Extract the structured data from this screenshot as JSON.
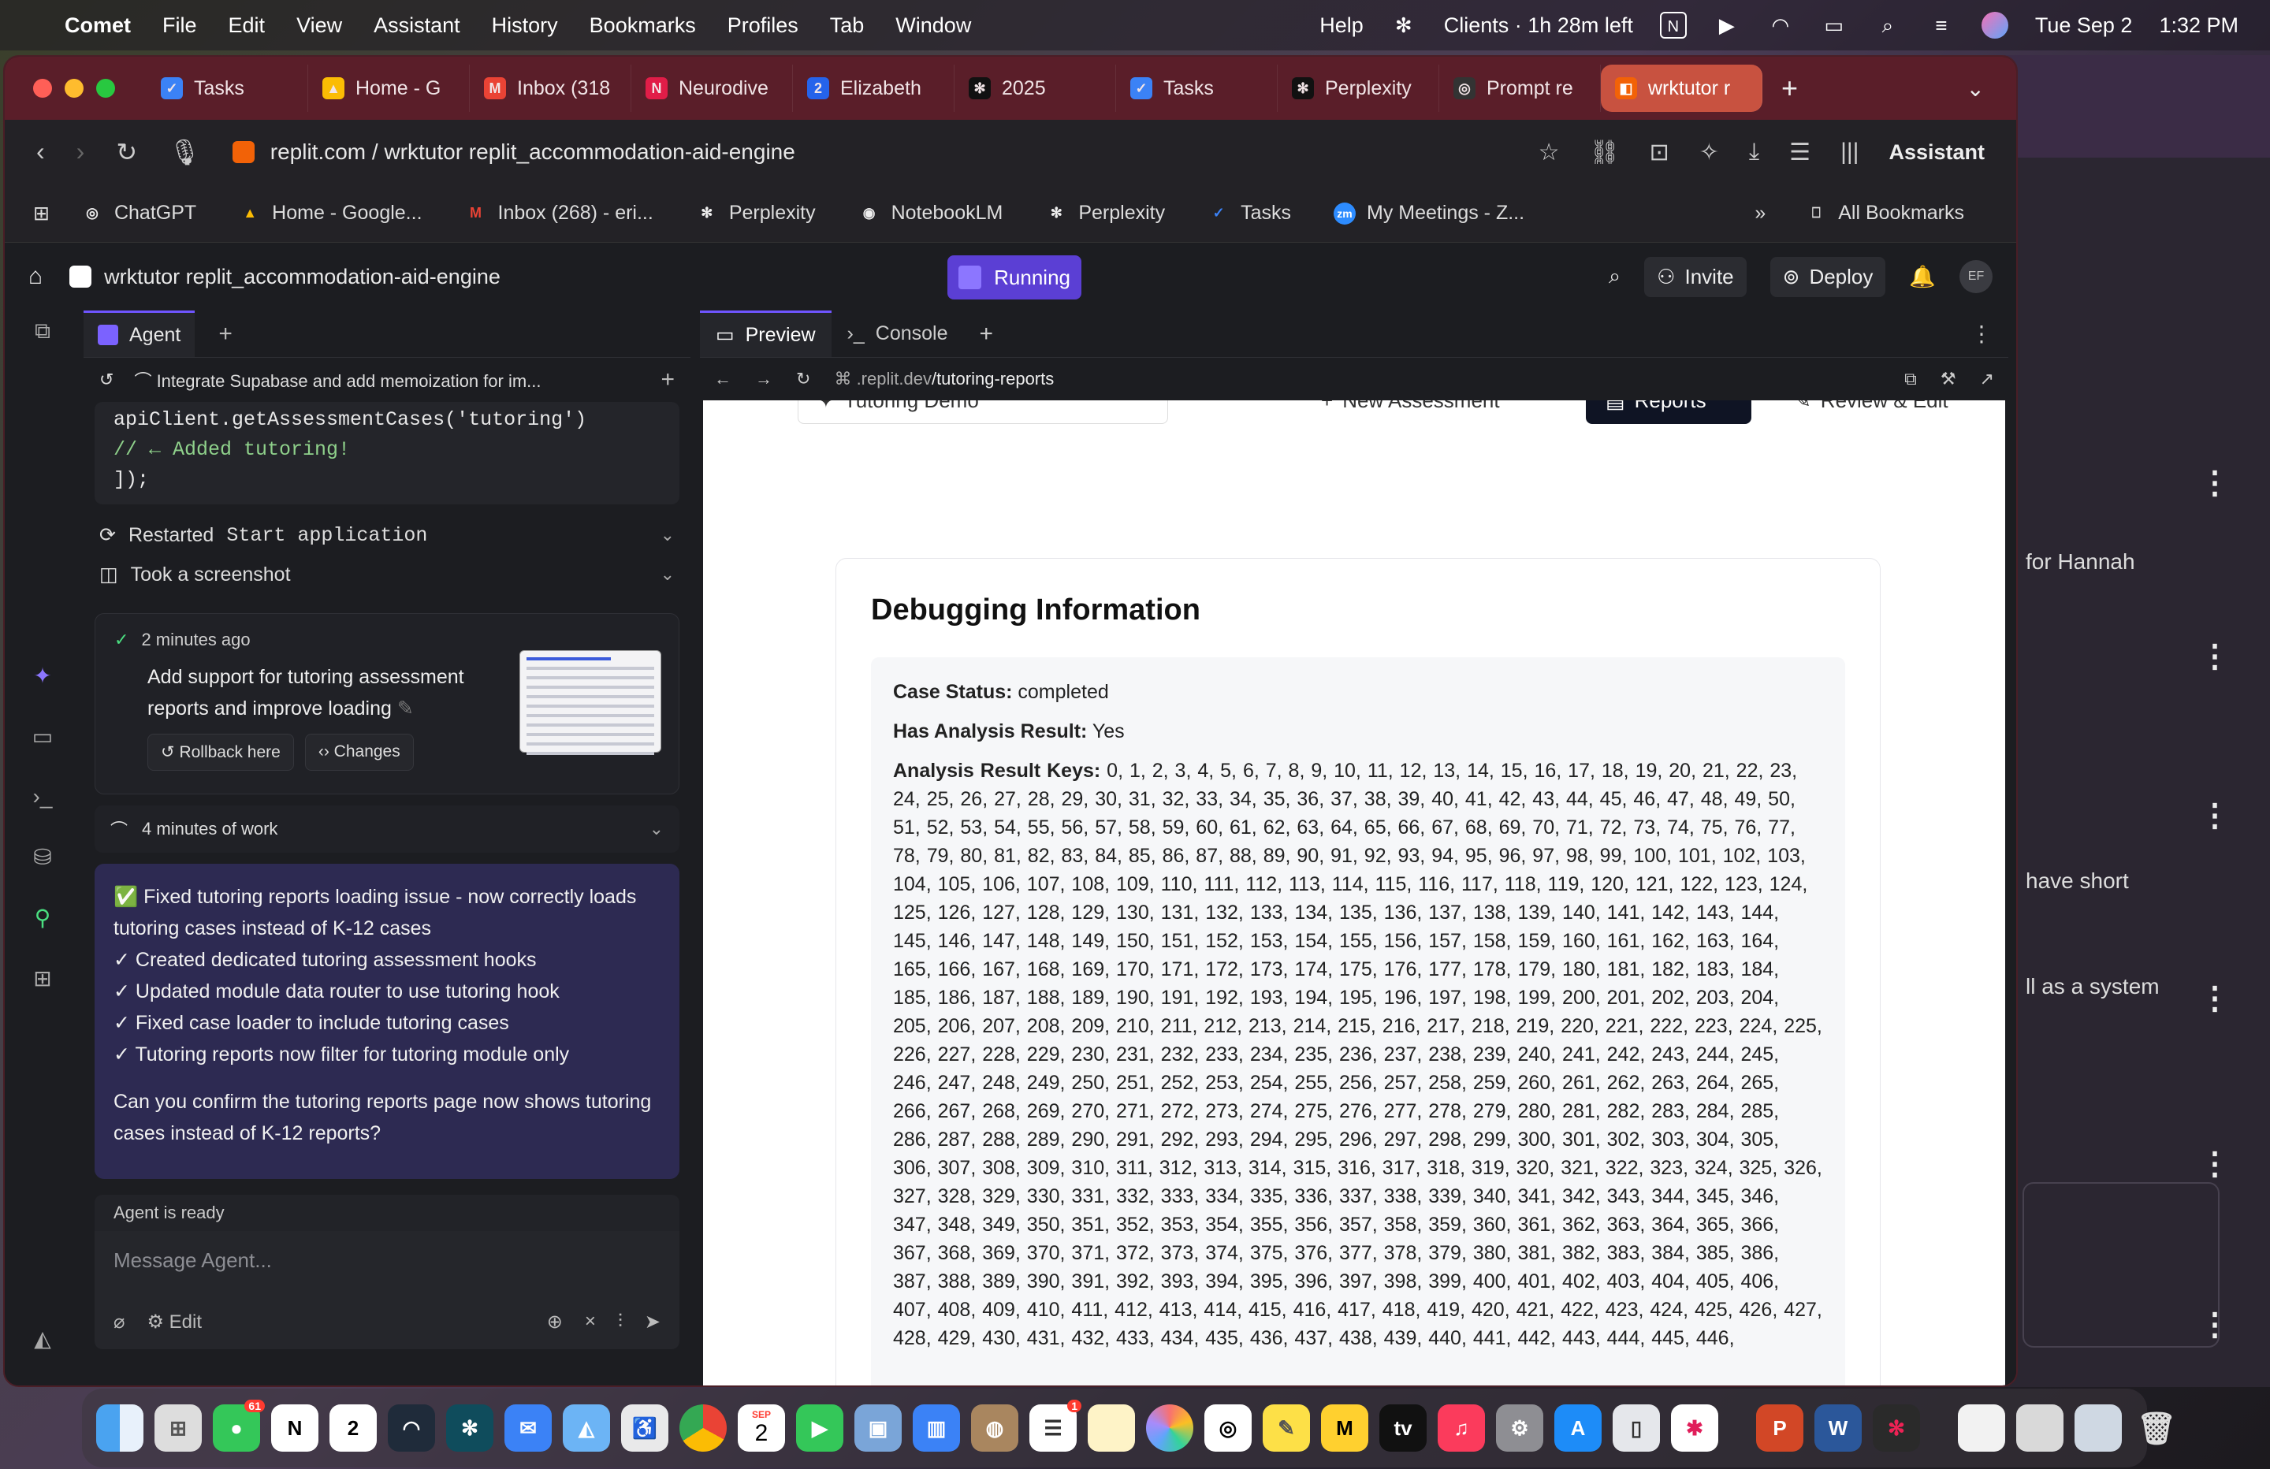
{
  "menubar": {
    "app": "Comet",
    "items": [
      "File",
      "Edit",
      "View",
      "Assistant",
      "History",
      "Bookmarks",
      "Profiles",
      "Tab",
      "Window"
    ],
    "help": "Help",
    "timer": "Clients · 1h 28m left",
    "date": "Tue Sep 2",
    "time": "1:32 PM"
  },
  "tabs": [
    {
      "label": "Tasks",
      "color": "#3b82f6"
    },
    {
      "label": "Home - G",
      "color": "#fbbc04"
    },
    {
      "label": "Inbox (318",
      "color": "#ea4335"
    },
    {
      "label": "Neurodive",
      "color": "#e11d48"
    },
    {
      "label": "Elizabeth",
      "color": "#2563eb"
    },
    {
      "label": "2025",
      "color": "#111111"
    },
    {
      "label": "Tasks",
      "color": "#3b82f6"
    },
    {
      "label": "Perplexity",
      "color": "#111111"
    },
    {
      "label": "Prompt re",
      "color": "#333333"
    },
    {
      "label": "wrktutor r",
      "color": "#f26207"
    }
  ],
  "toolbar": {
    "url": "replit.com / wrktutor replit_accommodation-aid-engine",
    "assistant": "Assistant"
  },
  "bookmarks": [
    {
      "label": "ChatGPT",
      "color": "#222222"
    },
    {
      "label": "Home - Google...",
      "color": "#fbbc04"
    },
    {
      "label": "Inbox (268) - eri...",
      "color": "#ea4335"
    },
    {
      "label": "Perplexity",
      "color": "#111111"
    },
    {
      "label": "NotebookLM",
      "color": "#222222"
    },
    {
      "label": "Perplexity",
      "color": "#111111"
    },
    {
      "label": "Tasks",
      "color": "#3b82f6"
    },
    {
      "label": "My Meetings - Z...",
      "color": "#2d8cff"
    }
  ],
  "all_bookmarks": "All Bookmarks",
  "replit": {
    "project": "wrktutor replit_accommodation-aid-engine",
    "status": "Running",
    "invite": "Invite",
    "deploy": "Deploy",
    "avatar": "EF"
  },
  "agent": {
    "tab": "Agent",
    "thread": "Integrate Supabase and add memoization for im...",
    "code": {
      "line1": "  apiClient.getAssessmentCases('tutoring')",
      "line2": "// ← Added tutoring!",
      "line3": "]);"
    },
    "restarted_prefix": "Restarted",
    "restarted_target": "Start application",
    "screenshot": "Took a screenshot",
    "checkpoint_time": "2 minutes ago",
    "checkpoint_msg": "Add support for tutoring assessment reports and improve loading",
    "rollback": "Rollback here",
    "changes": "Changes",
    "work": "4 minutes of work",
    "summary_lines": [
      "✅ Fixed tutoring reports loading issue - now correctly loads tutoring cases instead of K-12 cases",
      "✓ Created dedicated tutoring assessment hooks",
      "✓ Updated module data router to use tutoring hook",
      "✓ Fixed case loader to include tutoring cases",
      "✓ Tutoring reports now filter for tutoring module only"
    ],
    "summary_question": "Can you confirm the tutoring reports page now shows tutoring cases instead of K-12 reports?",
    "ready": "Agent is ready",
    "placeholder": "Message Agent...",
    "edit": "Edit"
  },
  "preview": {
    "tab_preview": "Preview",
    "tab_console": "Console",
    "url_prefix": ".replit.dev",
    "url_path": "/tutoring-reports",
    "nav": [
      "Tutoring Demo",
      "New Assessment",
      "Reports",
      "Review & Edit"
    ],
    "card_title": "Debugging Information",
    "case_status_label": "Case Status:",
    "case_status_value": "completed",
    "has_result_label": "Has Analysis Result:",
    "has_result_value": "Yes",
    "keys_label": "Analysis Result Keys:",
    "keys_value": "0, 1, 2, 3, 4, 5, 6, 7, 8, 9, 10, 11, 12, 13, 14, 15, 16, 17, 18, 19, 20, 21, 22, 23, 24, 25, 26, 27, 28, 29, 30, 31, 32, 33, 34, 35, 36, 37, 38, 39, 40, 41, 42, 43, 44, 45, 46, 47, 48, 49, 50, 51, 52, 53, 54, 55, 56, 57, 58, 59, 60, 61, 62, 63, 64, 65, 66, 67, 68, 69, 70, 71, 72, 73, 74, 75, 76, 77, 78, 79, 80, 81, 82, 83, 84, 85, 86, 87, 88, 89, 90, 91, 92, 93, 94, 95, 96, 97, 98, 99, 100, 101, 102, 103, 104, 105, 106, 107, 108, 109, 110, 111, 112, 113, 114, 115, 116, 117, 118, 119, 120, 121, 122, 123, 124, 125, 126, 127, 128, 129, 130, 131, 132, 133, 134, 135, 136, 137, 138, 139, 140, 141, 142, 143, 144, 145, 146, 147, 148, 149, 150, 151, 152, 153, 154, 155, 156, 157, 158, 159, 160, 161, 162, 163, 164, 165, 166, 167, 168, 169, 170, 171, 172, 173, 174, 175, 176, 177, 178, 179, 180, 181, 182, 183, 184, 185, 186, 187, 188, 189, 190, 191, 192, 193, 194, 195, 196, 197, 198, 199, 200, 201, 202, 203, 204, 205, 206, 207, 208, 209, 210, 211, 212, 213, 214, 215, 216, 217, 218, 219, 220, 221, 222, 223, 224, 225, 226, 227, 228, 229, 230, 231, 232, 233, 234, 235, 236, 237, 238, 239, 240, 241, 242, 243, 244, 245, 246, 247, 248, 249, 250, 251, 252, 253, 254, 255, 256, 257, 258, 259, 260, 261, 262, 263, 264, 265, 266, 267, 268, 269, 270, 271, 272, 273, 274, 275, 276, 277, 278, 279, 280, 281, 282, 283, 284, 285, 286, 287, 288, 289, 290, 291, 292, 293, 294, 295, 296, 297, 298, 299, 300, 301, 302, 303, 304, 305, 306, 307, 308, 309, 310, 311, 312, 313, 314, 315, 316, 317, 318, 319, 320, 321, 322, 323, 324, 325, 326, 327, 328, 329, 330, 331, 332, 333, 334, 335, 336, 337, 338, 339, 340, 341, 342, 343, 344, 345, 346, 347, 348, 349, 350, 351, 352, 353, 354, 355, 356, 357, 358, 359, 360, 361, 362, 363, 364, 365, 366, 367, 368, 369, 370, 371, 372, 373, 374, 375, 376, 377, 378, 379, 380, 381, 382, 383, 384, 385, 386, 387, 388, 389, 390, 391, 392, 393, 394, 395, 396, 397, 398, 399, 400, 401, 402, 403, 404, 405, 406, 407, 408, 409, 410, 411, 412, 413, 414, 415, 416, 417, 418, 419, 420, 421, 422, 423, 424, 425, 426, 427, 428, 429, 430, 431, 432, 433, 434, 435, 436, 437, 438, 439, 440, 441, 442, 443, 444, 445, 446,"
  },
  "background_app": {
    "lines": [
      "for Hannah",
      "have short",
      "ll as a system"
    ]
  },
  "dock_badges": {
    "messages": "61",
    "reminders": "1"
  },
  "dock_calendar": {
    "month": "SEP",
    "day": "2"
  }
}
